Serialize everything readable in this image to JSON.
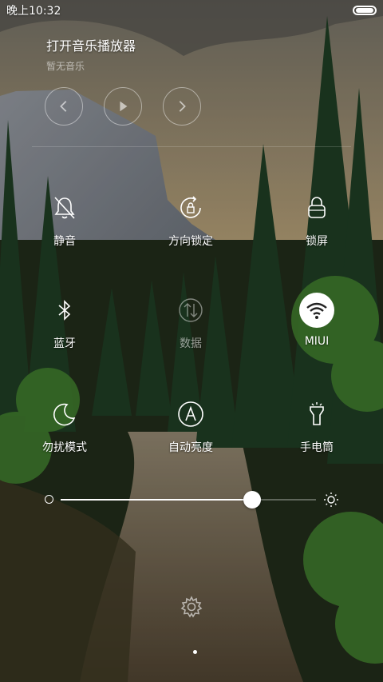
{
  "status": {
    "time": "晚上10:32"
  },
  "music": {
    "title": "打开音乐播放器",
    "subtitle": "暂无音乐"
  },
  "transport": {
    "prev": "prev",
    "play": "play",
    "next": "next"
  },
  "toggles": [
    {
      "id": "mute",
      "label": "静音",
      "icon": "bell-off-icon",
      "active": false,
      "dim": false
    },
    {
      "id": "rotation-lock",
      "label": "方向锁定",
      "icon": "rotation-lock-icon",
      "active": false,
      "dim": false
    },
    {
      "id": "lock-screen",
      "label": "锁屏",
      "icon": "lock-icon",
      "active": false,
      "dim": false
    },
    {
      "id": "bluetooth",
      "label": "蓝牙",
      "icon": "bluetooth-icon",
      "active": false,
      "dim": false
    },
    {
      "id": "data",
      "label": "数据",
      "icon": "data-icon",
      "active": false,
      "dim": true
    },
    {
      "id": "wifi",
      "label": "MIUI",
      "icon": "wifi-icon",
      "active": true,
      "dim": false
    },
    {
      "id": "dnd",
      "label": "勿扰模式",
      "icon": "moon-icon",
      "active": false,
      "dim": false
    },
    {
      "id": "auto-brightness",
      "label": "自动亮度",
      "icon": "auto-brightness-icon",
      "active": false,
      "dim": false
    },
    {
      "id": "flashlight",
      "label": "手电筒",
      "icon": "flashlight-icon",
      "active": false,
      "dim": false
    }
  ],
  "brightness": {
    "level": 0.75
  },
  "pager": {
    "current": 1,
    "total": 1
  }
}
